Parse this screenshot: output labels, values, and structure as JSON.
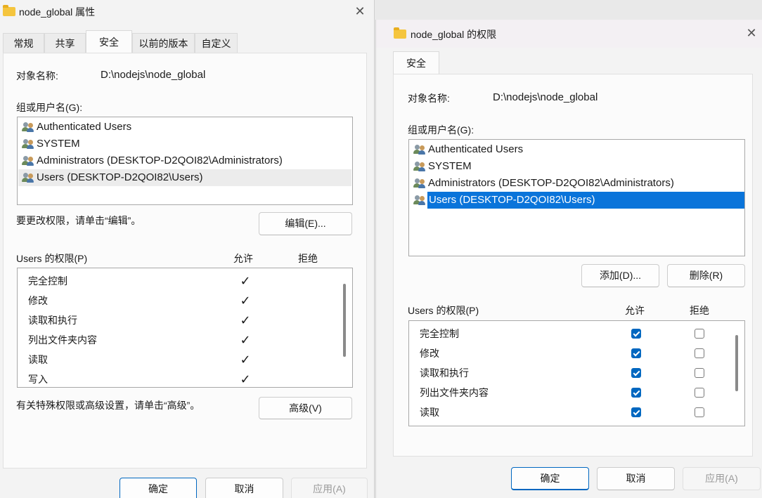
{
  "left_dialog": {
    "title": "node_global 属性",
    "tabs": [
      "常规",
      "共享",
      "安全",
      "以前的版本",
      "自定义"
    ],
    "active_tab": "安全",
    "object_label": "对象名称:",
    "object_value": "D:\\nodejs\\node_global",
    "group_label": "组或用户名(G):",
    "users": [
      "Authenticated Users",
      "SYSTEM",
      "Administrators (DESKTOP-D2QOI82\\Administrators)",
      "Users (DESKTOP-D2QOI82\\Users)"
    ],
    "edit_hint": "要更改权限，请单击“编辑”。",
    "edit_button": "编辑(E)...",
    "perm_title": "Users 的权限(P)",
    "allow_header": "允许",
    "deny_header": "拒绝",
    "permissions": [
      {
        "name": "完全控制",
        "allow": true,
        "deny": false
      },
      {
        "name": "修改",
        "allow": true,
        "deny": false
      },
      {
        "name": "读取和执行",
        "allow": true,
        "deny": false
      },
      {
        "name": "列出文件夹内容",
        "allow": true,
        "deny": false
      },
      {
        "name": "读取",
        "allow": true,
        "deny": false
      },
      {
        "name": "写入",
        "allow": true,
        "deny": false
      }
    ],
    "advanced_hint": "有关特殊权限或高级设置，请单击“高级”。",
    "advanced_button": "高级(V)",
    "ok_button": "确定",
    "cancel_button": "取消",
    "apply_button": "应用(A)"
  },
  "right_dialog": {
    "title": "node_global 的权限",
    "tab": "安全",
    "object_label": "对象名称:",
    "object_value": "D:\\nodejs\\node_global",
    "group_label": "组或用户名(G):",
    "users": [
      "Authenticated Users",
      "SYSTEM",
      "Administrators (DESKTOP-D2QOI82\\Administrators)",
      "Users (DESKTOP-D2QOI82\\Users)"
    ],
    "selected_user": "Users (DESKTOP-D2QOI82\\Users)",
    "add_button": "添加(D)...",
    "remove_button": "删除(R)",
    "perm_title": "Users 的权限(P)",
    "allow_header": "允许",
    "deny_header": "拒绝",
    "permissions": [
      {
        "name": "完全控制",
        "allow": true,
        "deny": false
      },
      {
        "name": "修改",
        "allow": true,
        "deny": false
      },
      {
        "name": "读取和执行",
        "allow": true,
        "deny": false
      },
      {
        "name": "列出文件夹内容",
        "allow": true,
        "deny": false
      },
      {
        "name": "读取",
        "allow": true,
        "deny": false
      }
    ],
    "ok_button": "确定",
    "cancel_button": "取消",
    "apply_button": "应用(A)"
  },
  "colors": {
    "accent": "#0067c0",
    "selection": "#0a74da",
    "folder": "#f5c53e"
  }
}
